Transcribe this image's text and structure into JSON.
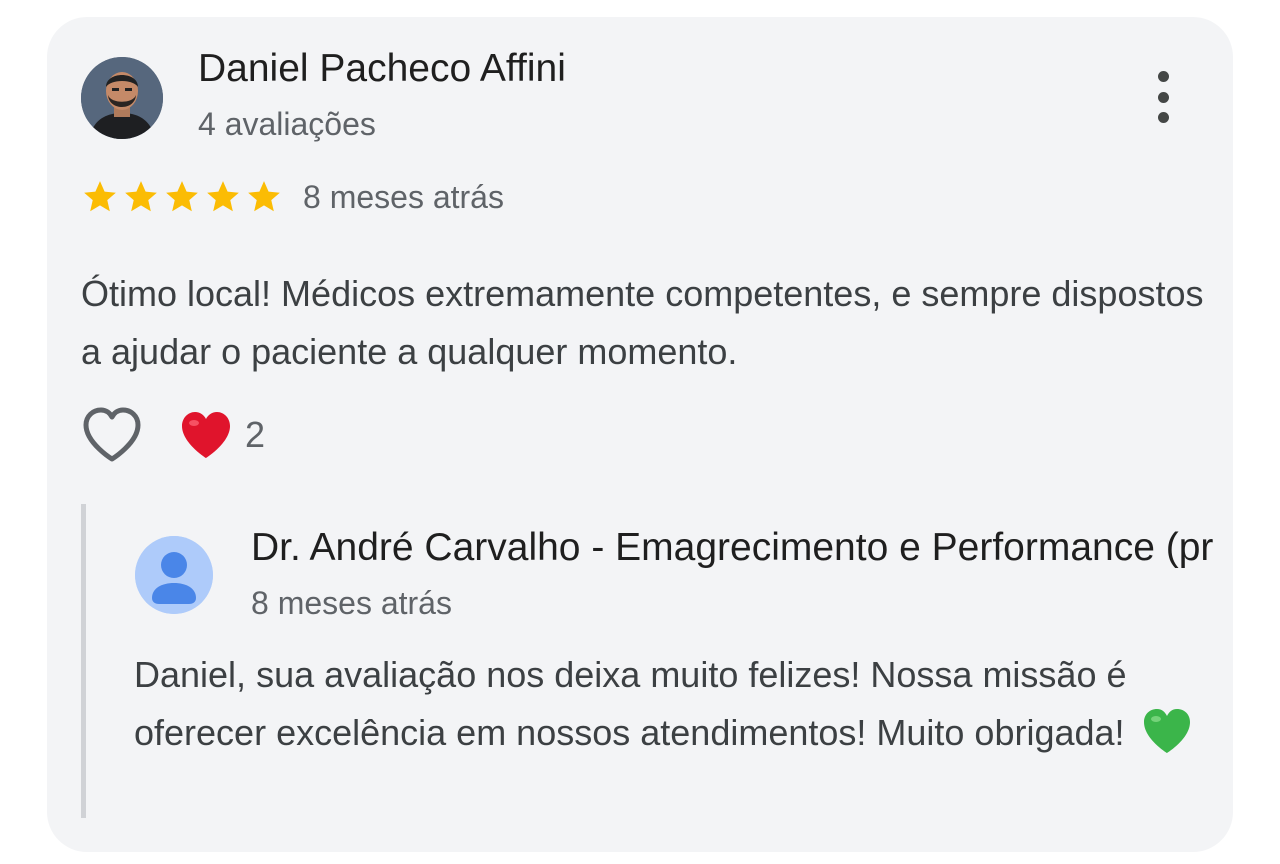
{
  "review": {
    "author": {
      "name": "Daniel Pacheco Affini",
      "meta": "4 avaliações"
    },
    "rating": 5,
    "rating_max": 5,
    "time": "8 meses atrás",
    "text": "Ótimo local! Médicos extremamente competentes, e sempre dispostos a ajudar o paciente a qualquer momento.",
    "reactions": {
      "heart_count": "2"
    },
    "menu_icon": "more-vert-icon"
  },
  "reply": {
    "name": "Dr. André Carvalho - Emagrecimento e Performance (pr",
    "time": "8 meses atrás",
    "text": "Daniel, sua avaliação nos deixa muito felizes! Nossa missão é oferecer excelência em nossos atendimentos! Muito obrigada!",
    "emoji": "green-heart-icon"
  },
  "colors": {
    "card_background": "#f3f4f6",
    "star": "#fbbc04",
    "heart_red": "#e0142c",
    "heart_green": "#3bb54a",
    "reply_avatar": "#aecbfa",
    "reply_avatar_figure": "#4a86e8"
  }
}
